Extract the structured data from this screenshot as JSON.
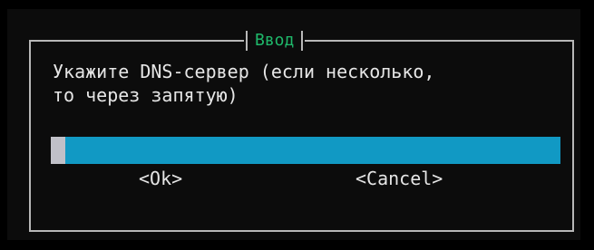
{
  "dialog": {
    "title": "Ввод",
    "prompt": "Укажите DNS-сервер (если несколько,\nто через запятую)",
    "input_value": "",
    "buttons": {
      "ok_label": "<Ok>",
      "cancel_label": "<Cancel>"
    }
  },
  "colors": {
    "background": "#000000",
    "frame": "#b8b8b8",
    "title": "#1fb96b",
    "input_field": "#1199c4",
    "cursor": "#c0c0c8",
    "text": "#e6e6e6"
  }
}
